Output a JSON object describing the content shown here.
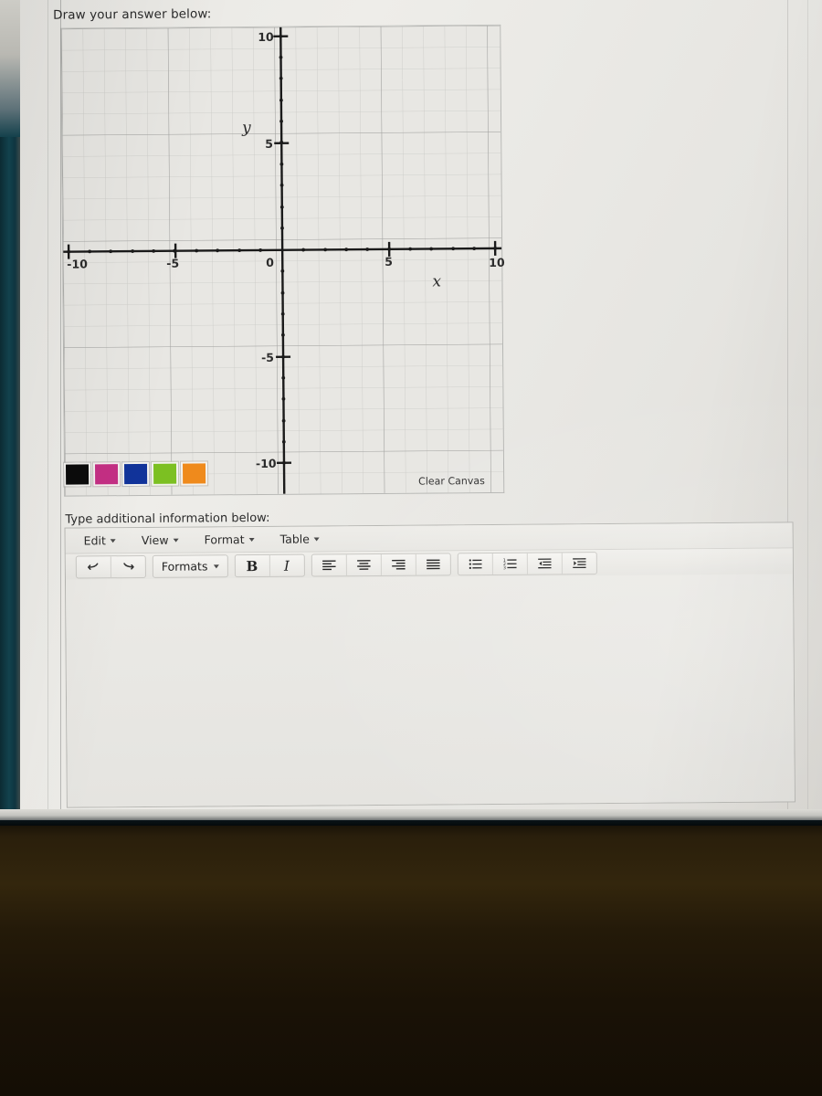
{
  "prompts": {
    "draw": "Draw your answer below:",
    "type": "Type additional information below:"
  },
  "canvas": {
    "clear_label": "Clear Canvas",
    "axis_labels": {
      "x": "x",
      "y": "y"
    },
    "x_ticks": [
      "-10",
      "-5",
      "0",
      "5",
      "10"
    ],
    "y_ticks": [
      "10",
      "5",
      "-5",
      "-10"
    ],
    "colors": [
      {
        "name": "black",
        "hex": "#0b0b0b"
      },
      {
        "name": "magenta",
        "hex": "#c42f84"
      },
      {
        "name": "blue",
        "hex": "#11339a"
      },
      {
        "name": "green",
        "hex": "#7cc022"
      },
      {
        "name": "orange",
        "hex": "#ef8a1c"
      }
    ]
  },
  "chart_data": {
    "type": "scatter",
    "title": "",
    "xlabel": "x",
    "ylabel": "y",
    "xlim": [
      -11,
      11
    ],
    "ylim": [
      -11,
      11
    ],
    "xticks": [
      -10,
      -5,
      0,
      5,
      10
    ],
    "yticks": [
      10,
      5,
      -5,
      -10
    ],
    "xtick_labels": [
      "-10",
      "-5",
      "0",
      "5",
      "10"
    ],
    "ytick_labels": [
      "10",
      "5",
      "-5",
      "-10"
    ],
    "grid": true,
    "grid_minor_step": 1,
    "grid_major_step": 5,
    "series": [],
    "annotations": [],
    "note": "empty blank coordinate plane; no data plotted by the student"
  },
  "editor": {
    "menus": [
      {
        "label": "Edit"
      },
      {
        "label": "View"
      },
      {
        "label": "Format"
      },
      {
        "label": "Table"
      }
    ],
    "toolbar": {
      "undo": "undo-icon",
      "redo": "redo-icon",
      "formats_label": "Formats",
      "bold_label": "B",
      "italic_label": "I",
      "align_left": "align-left-icon",
      "align_center": "align-center-icon",
      "align_right": "align-right-icon",
      "align_justify": "align-justify-icon",
      "bullet_list": "bullet-list-icon",
      "numbered_list": "numbered-list-icon",
      "outdent": "outdent-icon",
      "indent": "indent-icon"
    },
    "body_value": "",
    "body_placeholder": ""
  }
}
